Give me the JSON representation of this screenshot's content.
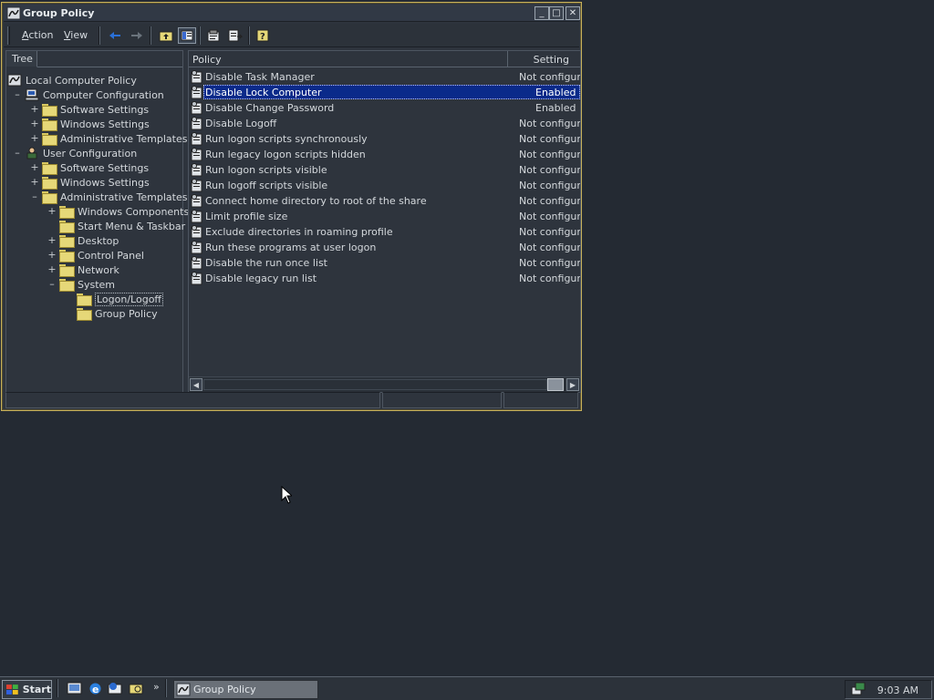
{
  "window": {
    "title": "Group Policy",
    "buttons": {
      "minimize": "_",
      "maximize": "□",
      "close": "✕"
    }
  },
  "menu": {
    "action": {
      "accel": "A",
      "rest": "ction"
    },
    "view": {
      "accel": "V",
      "rest": "iew"
    }
  },
  "toolbar": {
    "icons": [
      "back-arrow-icon",
      "forward-arrow-icon",
      "up-folder-icon",
      "show-hide-tree-icon",
      "properties-icon",
      "export-list-icon",
      "help-icon"
    ]
  },
  "tree": {
    "tab_label": "Tree",
    "items": [
      {
        "label": "Local Computer Policy",
        "expander": ""
      },
      {
        "label": "Computer Configuration",
        "expander": "–"
      },
      {
        "label": "Software Settings",
        "expander": "+"
      },
      {
        "label": "Windows Settings",
        "expander": "+"
      },
      {
        "label": "Administrative Templates",
        "expander": "+"
      },
      {
        "label": "User Configuration",
        "expander": "–"
      },
      {
        "label": "Software Settings",
        "expander": "+"
      },
      {
        "label": "Windows Settings",
        "expander": "+"
      },
      {
        "label": "Administrative Templates",
        "expander": "–"
      },
      {
        "label": "Windows Components",
        "expander": "+"
      },
      {
        "label": "Start Menu & Taskbar",
        "expander": ""
      },
      {
        "label": "Desktop",
        "expander": "+"
      },
      {
        "label": "Control Panel",
        "expander": "+"
      },
      {
        "label": "Network",
        "expander": "+"
      },
      {
        "label": "System",
        "expander": "–"
      },
      {
        "label": "Logon/Logoff",
        "expander": ""
      },
      {
        "label": "Group Policy",
        "expander": ""
      }
    ]
  },
  "list": {
    "columns": {
      "policy": "Policy",
      "setting": "Setting"
    },
    "rows": [
      {
        "policy": "Disable Task Manager",
        "setting": "Not configured"
      },
      {
        "policy": "Disable Lock Computer",
        "setting": "Enabled"
      },
      {
        "policy": "Disable Change Password",
        "setting": "Enabled"
      },
      {
        "policy": "Disable Logoff",
        "setting": "Not configured"
      },
      {
        "policy": "Run logon scripts synchronously",
        "setting": "Not configured"
      },
      {
        "policy": "Run legacy logon scripts hidden",
        "setting": "Not configured"
      },
      {
        "policy": "Run logon scripts visible",
        "setting": "Not configured"
      },
      {
        "policy": "Run logoff scripts visible",
        "setting": "Not configured"
      },
      {
        "policy": "Connect home directory to root of the share",
        "setting": "Not configured"
      },
      {
        "policy": "Limit profile size",
        "setting": "Not configured"
      },
      {
        "policy": "Exclude directories in roaming profile",
        "setting": "Not configured"
      },
      {
        "policy": "Run these programs at user logon",
        "setting": "Not configured"
      },
      {
        "policy": "Disable the run once list",
        "setting": "Not configured"
      },
      {
        "policy": "Disable legacy run list",
        "setting": "Not configured"
      }
    ],
    "selected_row": "Disable Lock Computer"
  },
  "taskbar": {
    "start_label": "Start",
    "quick_launch": [
      "show-desktop-icon",
      "internet-explorer-icon",
      "outlook-express-icon",
      "windows-explorer-icon"
    ],
    "overflow": "»",
    "task_label": "Group Policy",
    "clock": "9:03 AM"
  }
}
